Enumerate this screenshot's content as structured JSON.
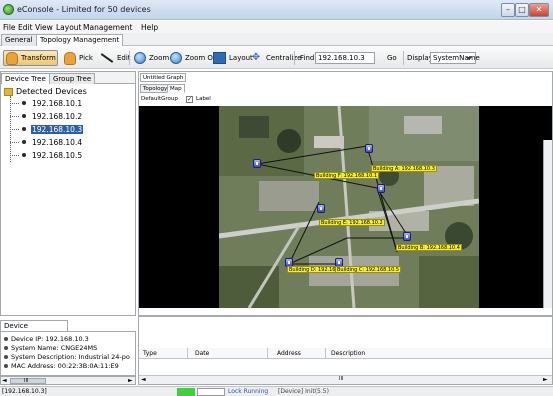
{
  "window": {
    "title": "eConsole - Limited for 50 devices",
    "controls": [
      "–",
      "□",
      "✕"
    ]
  },
  "menu": {
    "items": [
      "File",
      "Edit",
      "View",
      "Layout",
      "Management",
      "Help"
    ]
  },
  "top_tabs": [
    "General",
    "Topology Management"
  ],
  "toolbar": {
    "transform": "Transform",
    "pick": "Pick",
    "edit": "Edit",
    "zoom_in": "Zoom in",
    "zoom_out": "Zoom Out",
    "layout": "Layout",
    "centralize": "Centralize",
    "find_label": "Find",
    "find_value": "192.168.10.3",
    "go": "Go",
    "display_label": "Display",
    "display_value": "SystemName"
  },
  "left_tabs": [
    "Device Tree",
    "Group Tree"
  ],
  "tree": {
    "root": "Detected Devices",
    "devices": [
      "192.168.10.1",
      "192.168.10.2",
      "192.168.10.3",
      "192.168.10.4",
      "192.168.10.5"
    ],
    "selected_index": 2
  },
  "device_info": {
    "tab": "Device Information",
    "lines": [
      "Device IP: 192.168.10.3",
      "System Name: CNGE24MS",
      "System Description: Industrial 24-po",
      "MAC Address: 00:22:3B:0A:11:E9"
    ]
  },
  "left_scroll": {
    "left": "◄",
    "grip": "III",
    "right": "►"
  },
  "graph": {
    "doc_tab": "Untitled Graph",
    "view_tabs": [
      "Topology",
      "Map"
    ],
    "active_view": "Map",
    "group": "DefaultGroup",
    "label_checkbox": {
      "text": "Label",
      "checked": true
    }
  },
  "map_nodes": [
    {
      "id": "A",
      "label": "Building A: 192.168.10.3"
    },
    {
      "id": "F",
      "label": "Building F: 192.168.10.1"
    },
    {
      "id": "E",
      "label": "Building E: 192.168.10.2"
    },
    {
      "id": "B",
      "label": "Building B: 192.168.10.4"
    },
    {
      "id": "D",
      "label": "Building D: 192.168.10.4"
    },
    {
      "id": "C",
      "label": "Building C: 192.168.10.5"
    }
  ],
  "log": {
    "columns": [
      "Type",
      "Date",
      "Address",
      "Description"
    ],
    "scroll": {
      "left": "◄",
      "grip": "III",
      "right": "►"
    }
  },
  "status": {
    "ip": "[192.168.10.3]",
    "lock": "Lock Running",
    "dev": "[Device] Init(5.5)"
  },
  "colors": {
    "selection": "#2d5fa8",
    "node_label": "#f4ee2d",
    "status_ok": "#3bd33b"
  }
}
